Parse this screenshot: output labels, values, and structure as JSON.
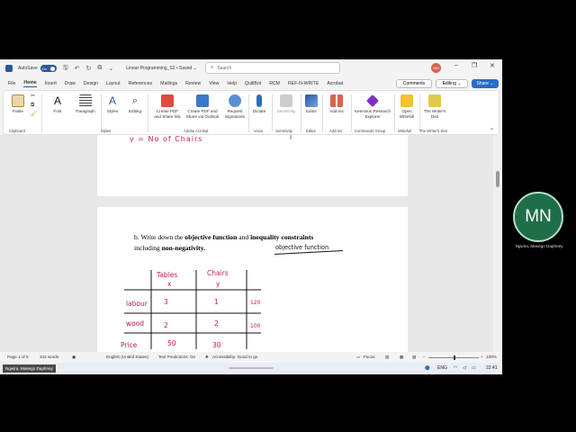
{
  "titlebar": {
    "autosave_label": "AutoSave",
    "autosave_state": "On",
    "doc_title": "Linear Programming_S2 • Saved ⌄",
    "search_placeholder": "Search",
    "user_initials": "NM",
    "minimize": "–",
    "restore": "❐",
    "close": "✕"
  },
  "menu": {
    "tabs": [
      "File",
      "Home",
      "Insert",
      "Draw",
      "Design",
      "Layout",
      "References",
      "Mailings",
      "Review",
      "View",
      "Help",
      "QuillBot",
      "RCM",
      "REF-N-WRITE",
      "Acrobat"
    ],
    "comments": "Comments",
    "editing": "Editing ⌄",
    "share": "Share ⌄"
  },
  "ribbon": {
    "paste": "Paste",
    "font": "Font",
    "paragraph": "Paragraph",
    "styles": "Styles",
    "editing": "Editing",
    "create_pdf_share": "Create PDF and Share link",
    "create_pdf_outlook": "Create PDF and Share via Outlook",
    "request_signatures": "Request Signatures",
    "dictate": "Dictate",
    "sensitivity": "Sensitivity",
    "editor": "Editor",
    "addins": "Add-ins",
    "keenious": "Keenious Research Explorer",
    "open_writefull": "Open Writefull",
    "writers_diet": "The Writer's Diet",
    "groups": {
      "clipboard": "Clipboard",
      "styles": "Styles",
      "adobe": "Adobe Acrobat",
      "voice": "Voice",
      "sensitivity": "Sensitivity",
      "editor": "Editor",
      "addins": "Add-ins",
      "commands": "Commands Group",
      "writefull": "Writefull",
      "writers_diet": "The Writer's Diet"
    }
  },
  "document": {
    "handwriting_top": "y = No of Chairs",
    "question_prefix": "b. Write down the ",
    "question_bold1": "objective function",
    "question_mid": " and ",
    "question_bold2": "inequality constraints",
    "question_line2_prefix": "including ",
    "question_bold3": "non-negativity.",
    "objective_label": "objective function",
    "table": {
      "col1_header": "Tables",
      "col1_var": "x",
      "col2_header": "Chairs",
      "col2_var": "y",
      "rows": [
        {
          "label": "labour",
          "tables": "3",
          "chairs": "1",
          "limit": "120"
        },
        {
          "label": "wood",
          "tables": "2",
          "chairs": "2",
          "limit": "100"
        },
        {
          "label": "Price",
          "tables": "50",
          "chairs": "30",
          "limit": ""
        }
      ]
    }
  },
  "status": {
    "page": "Page 1 of 5",
    "words": "344 words",
    "language": "English (United States)",
    "predictions": "Text Predictions: On",
    "accessibility": "Accessibility: Good to go",
    "focus": "Focus",
    "zoom": "100%"
  },
  "taskbar": {
    "name": "Ngwira, Masego Daphney",
    "lang": "ENG",
    "time": "22:41"
  },
  "participant": {
    "initials": "MN",
    "name": "Ngwira, Masego Daphney"
  },
  "colors": {
    "accent": "#2b579a",
    "ink": "#c2185b",
    "avatar": "#1f6e4a"
  }
}
